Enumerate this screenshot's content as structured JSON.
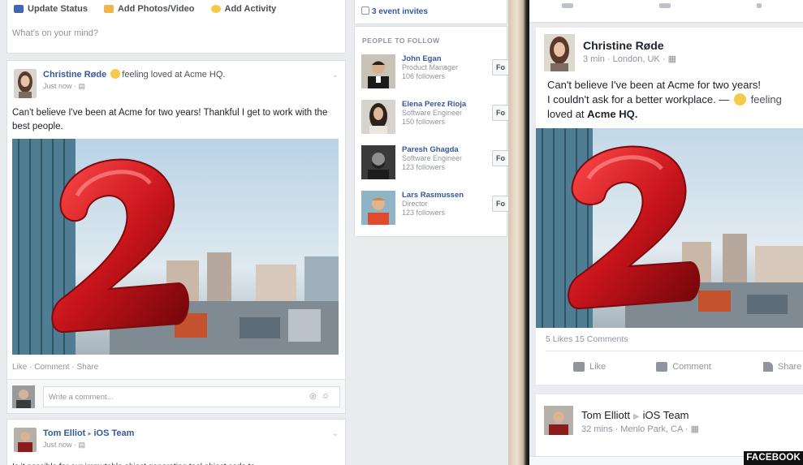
{
  "composer": {
    "update_status": "Update Status",
    "add_photo": "Add Photos/Video",
    "add_activity": "Add Activity",
    "placeholder": "What's on your mind?"
  },
  "post1": {
    "author": "Christine Røde",
    "feeling": "feeling loved at Acme HQ.",
    "time": "Just now",
    "text": "Can't believe I've been at Acme for two years! Thankful I get to work with the best people.",
    "actions": "Like · Comment · Share",
    "comment_placeholder": "Write a comment..."
  },
  "post2": {
    "author": "Tom Elliot",
    "group": "iOS Team",
    "time": "Just now",
    "text": "Is it possible for our immutable object generating tool object code to"
  },
  "sidebar": {
    "invites": "3 event invites",
    "people_title": "PEOPLE TO FOLLOW",
    "people": [
      {
        "name": "John Egan",
        "title": "Product Manager",
        "followers": "106 followers",
        "button": "Fo"
      },
      {
        "name": "Elena Perez Rioja",
        "title": "Software Engineer",
        "followers": "150 followers",
        "button": "Fo"
      },
      {
        "name": "Paresh Ghagda",
        "title": "Software Engineer",
        "followers": "123 followers",
        "button": "Fo"
      },
      {
        "name": "Lars Rasmussen",
        "title": "Director",
        "followers": "123 followers",
        "button": "Fo"
      }
    ]
  },
  "phone": {
    "post1": {
      "author": "Christine Røde",
      "meta": "3 min · London, UK · ",
      "line1": "Can't believe I've been at Acme for two years!",
      "line2_start": "I couldn't ask for a better workplace. —",
      "line2_feeling": "feeling",
      "line3_start": "loved at",
      "line3_bold": "Acme HQ.",
      "stats": "5 Likes  15 Comments",
      "like": "Like",
      "comment": "Comment",
      "share": "Share"
    },
    "post2": {
      "author": "Tom Elliott",
      "group": "iOS Team",
      "meta": "32 mins · Menlo Park, CA · "
    }
  },
  "watermark": "FACEBOOK",
  "colors": {
    "link": "#365899",
    "balloon": "#c8141b",
    "background": "#e9ebee"
  }
}
